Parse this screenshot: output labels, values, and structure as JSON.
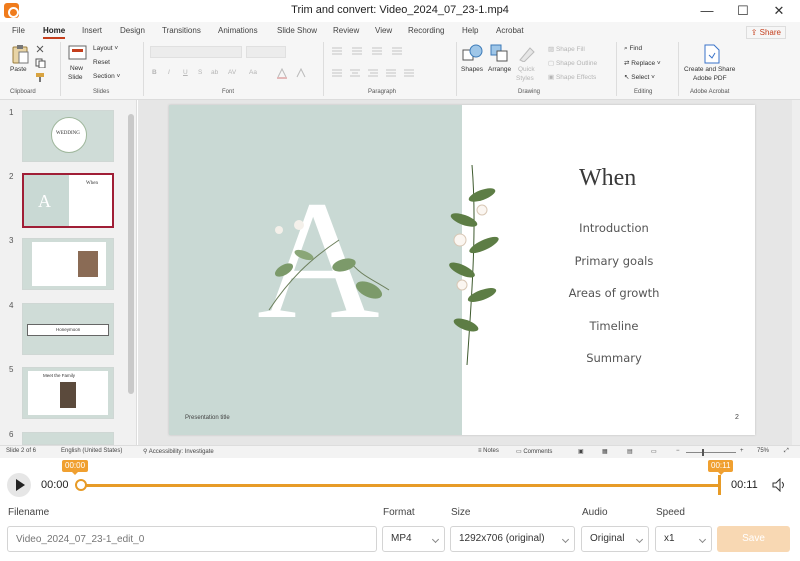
{
  "window": {
    "title": "Trim and convert: Video_2024_07_23-1.mp4",
    "minimize": "—",
    "maximize": "☐",
    "close": "✕"
  },
  "ribbon": {
    "tabs": [
      "File",
      "Home",
      "Insert",
      "Design",
      "Transitions",
      "Animations",
      "Slide Show",
      "Review",
      "View",
      "Recording",
      "Help",
      "Acrobat"
    ],
    "active_tab": "Home",
    "share_label": "Share",
    "clipboard": {
      "paste": "Paste",
      "label": "Clipboard"
    },
    "slides": {
      "new_slide_line1": "New",
      "new_slide_line2": "Slide",
      "layout": "Layout",
      "reset": "Reset",
      "section": "Section",
      "label": "Slides"
    },
    "font": {
      "label": "Font",
      "buttons": [
        "B",
        "I",
        "U",
        "S",
        "ab",
        "AV",
        "Aa"
      ]
    },
    "paragraph": {
      "label": "Paragraph"
    },
    "drawing": {
      "shapes": "Shapes",
      "arrange": "Arrange",
      "quick_line1": "Quick",
      "quick_line2": "Styles",
      "shape_fill": "Shape Fill",
      "shape_outline": "Shape Outline",
      "shape_effects": "Shape Effects",
      "label": "Drawing"
    },
    "editing": {
      "find": "Find",
      "replace": "Replace",
      "select": "Select",
      "label": "Editing"
    },
    "acrobat": {
      "create_line1": "Create and Share",
      "create_line2": "Adobe PDF",
      "label": "Adobe Acrobat"
    }
  },
  "thumbnails": {
    "numbers": [
      "1",
      "2",
      "3",
      "4",
      "5",
      "6"
    ],
    "selected": "2",
    "slide1_text": "WEDDING",
    "slide2_text": "When",
    "slide4_text": "Honeymoon",
    "slide5_text": "Meet the Family"
  },
  "slide": {
    "heading": "When",
    "items": [
      "Introduction",
      "Primary goals",
      "Areas of growth",
      "Timeline",
      "Summary"
    ],
    "letter": "A",
    "presentation_title": "Presentation title",
    "number": "2"
  },
  "status": {
    "slide": "Slide 2 of 6",
    "language": "English (United States)",
    "accessibility": "Accessibility: Investigate",
    "notes": "Notes",
    "comments": "Comments",
    "zoom": "75%"
  },
  "player": {
    "current_time": "00:00",
    "end_time": "00:11",
    "start_marker": "00:00",
    "end_marker": "00:11"
  },
  "export": {
    "filename_label": "Filename",
    "filename_placeholder": "Video_2024_07_23-1_edit_0",
    "format_label": "Format",
    "format_value": "MP4",
    "size_label": "Size",
    "size_value": "1292x706 (original)",
    "audio_label": "Audio",
    "audio_value": "Original",
    "speed_label": "Speed",
    "speed_value": "x1",
    "save_label": "Save"
  },
  "colors": {
    "accent": "#e79b27",
    "brand": "#c43e1c",
    "slide_bg": "#c9d9d4"
  }
}
